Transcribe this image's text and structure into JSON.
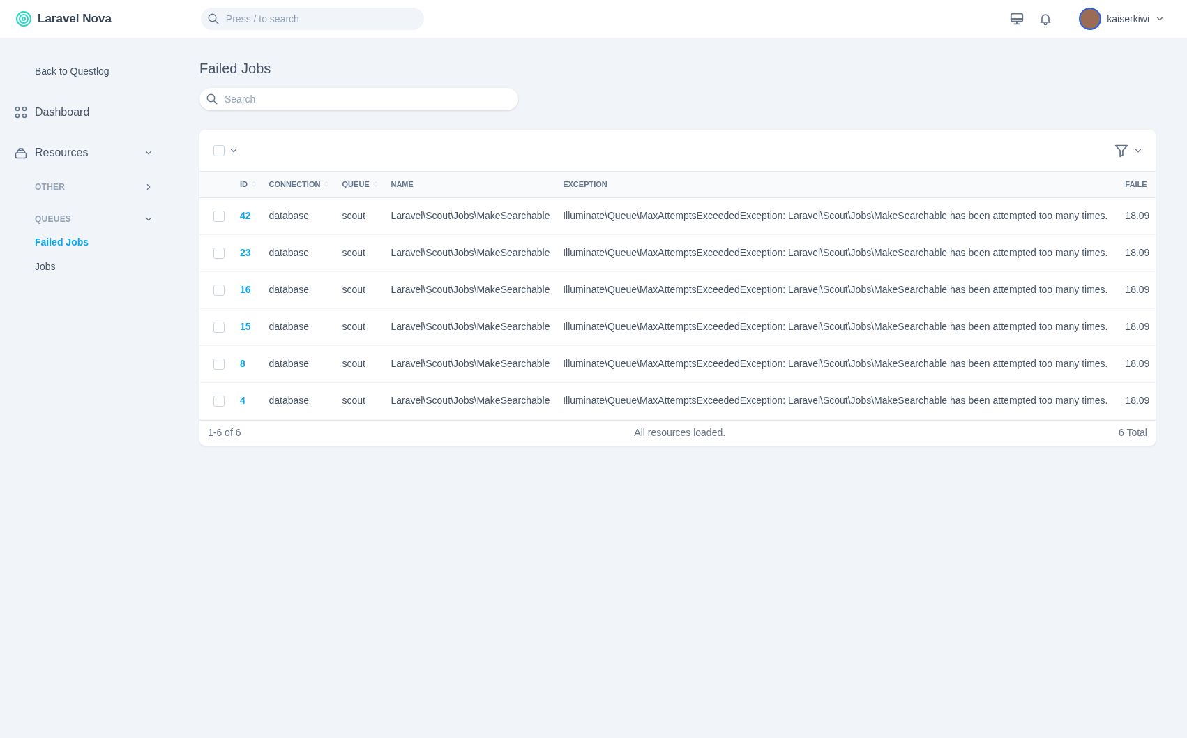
{
  "app": {
    "name": "Laravel Nova"
  },
  "global_search": {
    "placeholder": "Press / to search"
  },
  "user": {
    "name": "kaiserkiwi"
  },
  "sidebar": {
    "back_link": "Back to Questlog",
    "items": [
      {
        "label": "Dashboard",
        "kind": "link"
      },
      {
        "label": "Resources",
        "kind": "section",
        "expanded": true,
        "children": [
          {
            "label": "OTHER",
            "expanded": false
          },
          {
            "label": "QUEUES",
            "expanded": true,
            "children": [
              {
                "label": "Failed Jobs",
                "selected": true
              },
              {
                "label": "Jobs",
                "selected": false
              }
            ]
          }
        ]
      }
    ]
  },
  "page": {
    "title": "Failed Jobs",
    "search": {
      "placeholder": "Search"
    }
  },
  "table": {
    "select_all": {
      "checked": false
    },
    "columns": [
      {
        "label": "ID",
        "sortable": true
      },
      {
        "label": "CONNECTION",
        "sortable": true
      },
      {
        "label": "QUEUE",
        "sortable": true
      },
      {
        "label": "NAME",
        "sortable": false
      },
      {
        "label": "EXCEPTION",
        "sortable": false
      },
      {
        "label": "FAILE",
        "sortable": false
      }
    ],
    "rows": [
      {
        "checked": false,
        "cells": [
          "42",
          "database",
          "scout",
          "Laravel\\Scout\\Jobs\\MakeSearchable",
          "Illuminate\\Queue\\MaxAttemptsExceededException: Laravel\\Scout\\Jobs\\MakeSearchable has been attempted too many times.",
          "18.09"
        ]
      },
      {
        "checked": false,
        "cells": [
          "23",
          "database",
          "scout",
          "Laravel\\Scout\\Jobs\\MakeSearchable",
          "Illuminate\\Queue\\MaxAttemptsExceededException: Laravel\\Scout\\Jobs\\MakeSearchable has been attempted too many times.",
          "18.09"
        ]
      },
      {
        "checked": false,
        "cells": [
          "16",
          "database",
          "scout",
          "Laravel\\Scout\\Jobs\\MakeSearchable",
          "Illuminate\\Queue\\MaxAttemptsExceededException: Laravel\\Scout\\Jobs\\MakeSearchable has been attempted too many times.",
          "18.09"
        ]
      },
      {
        "checked": false,
        "cells": [
          "15",
          "database",
          "scout",
          "Laravel\\Scout\\Jobs\\MakeSearchable",
          "Illuminate\\Queue\\MaxAttemptsExceededException: Laravel\\Scout\\Jobs\\MakeSearchable has been attempted too many times.",
          "18.09"
        ]
      },
      {
        "checked": false,
        "cells": [
          "8",
          "database",
          "scout",
          "Laravel\\Scout\\Jobs\\MakeSearchable",
          "Illuminate\\Queue\\MaxAttemptsExceededException: Laravel\\Scout\\Jobs\\MakeSearchable has been attempted too many times.",
          "18.09"
        ]
      },
      {
        "checked": false,
        "cells": [
          "4",
          "database",
          "scout",
          "Laravel\\Scout\\Jobs\\MakeSearchable",
          "Illuminate\\Queue\\MaxAttemptsExceededException: Laravel\\Scout\\Jobs\\MakeSearchable has been attempted too many times.",
          "18.09"
        ]
      }
    ],
    "footer": {
      "range": "1-6 of 6",
      "status": "All resources loaded.",
      "total": "6 Total"
    }
  }
}
